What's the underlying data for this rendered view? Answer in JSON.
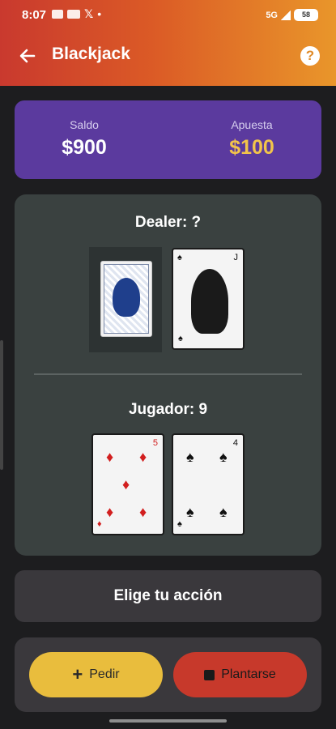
{
  "status": {
    "time": "8:07",
    "icons": [
      "app-icon",
      "youtube-icon",
      "x-icon",
      "dot"
    ],
    "x_glyph": "𝕏",
    "dot_glyph": "•",
    "network": "5G",
    "battery": "58"
  },
  "header": {
    "title": "Blackjack",
    "help_glyph": "?"
  },
  "balance": {
    "saldo_label": "Saldo",
    "saldo_value": "$900",
    "apuesta_label": "Apuesta",
    "apuesta_value": "$100"
  },
  "dealer": {
    "label": "Dealer: ?",
    "cards": [
      {
        "face": "hidden"
      },
      {
        "rank": "J",
        "suit": "spades",
        "suit_glyph": "♠"
      }
    ]
  },
  "player": {
    "label": "Jugador: 9",
    "cards": [
      {
        "rank": "5",
        "suit": "diamonds",
        "suit_glyph": "♦"
      },
      {
        "rank": "4",
        "suit": "spades",
        "suit_glyph": "♠"
      }
    ]
  },
  "action": {
    "prompt": "Elige tu acción"
  },
  "buttons": {
    "hit_label": "Pedir",
    "hit_icon": "+",
    "stand_label": "Plantarse"
  },
  "colors": {
    "header_gradient": [
      "#c9392e",
      "#e9962a"
    ],
    "balance_card": "#5b3a9e",
    "bet_value": "#f2c44a",
    "table": "#3a4140",
    "hit_button": "#e9bd3d",
    "stand_button": "#c7392b"
  }
}
